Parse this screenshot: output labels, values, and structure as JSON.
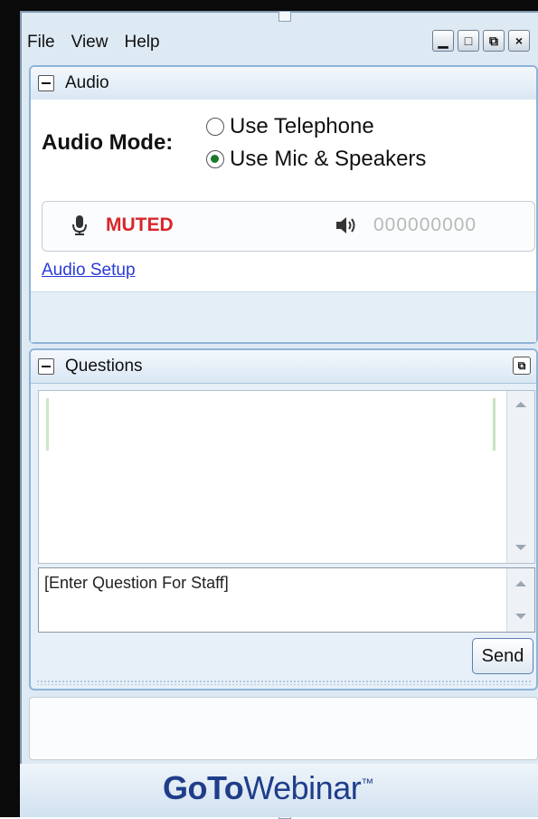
{
  "menu": {
    "items": [
      "File",
      "View",
      "Help"
    ]
  },
  "window_controls": {
    "minimize": "▁",
    "maximize": "□",
    "restore": "⧉",
    "close": "×"
  },
  "audio_panel": {
    "title": "Audio",
    "mode_label": "Audio Mode:",
    "options": [
      {
        "label": "Use Telephone",
        "selected": false
      },
      {
        "label": "Use Mic & Speakers",
        "selected": true
      }
    ],
    "mic_status": "MUTED",
    "speaker_level": "000000000",
    "setup_link": "Audio Setup"
  },
  "questions_panel": {
    "title": "Questions",
    "input_placeholder": "[Enter Question For Staff]",
    "send_label": "Send"
  },
  "footer": {
    "brand_bold": "GoTo",
    "brand_rest": "Webinar",
    "tm": "™"
  },
  "colors": {
    "accent_blue": "#1f3d8a",
    "muted_red": "#d8262b",
    "link": "#2a3bd6",
    "panel_border": "#8fb4d8"
  }
}
